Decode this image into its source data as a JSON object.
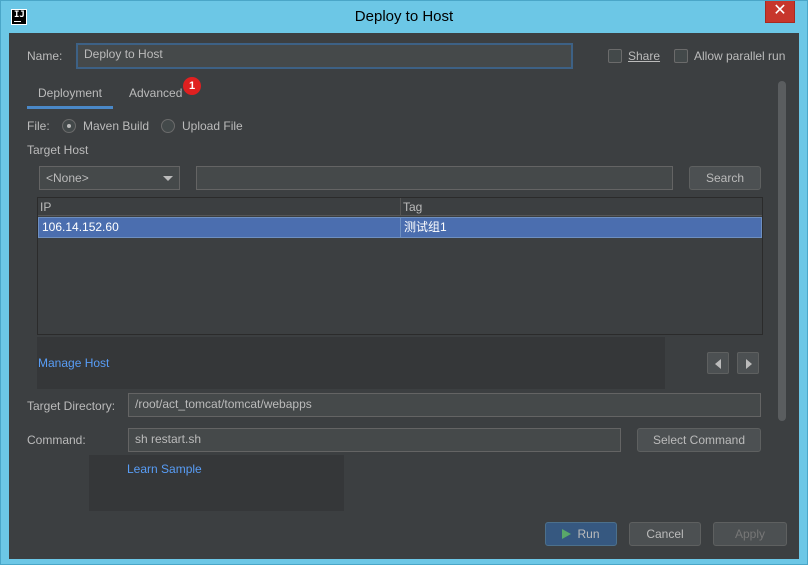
{
  "window": {
    "title": "Deploy to Host",
    "app_icon": "IJ",
    "close_symbol": "✕"
  },
  "name_row": {
    "label": "Name:",
    "value": "Deploy to Host",
    "share_label": "Share",
    "parallel_label": "Allow parallel run"
  },
  "tabs": [
    {
      "label": "Deployment"
    },
    {
      "label": "Advanced"
    }
  ],
  "badge": "1",
  "file_row": {
    "label": "File:",
    "options": [
      {
        "label": "Maven Build"
      },
      {
        "label": "Upload File"
      }
    ]
  },
  "target_host": {
    "label": "Target Host",
    "dropdown_value": "<None>",
    "search_value": "",
    "search_button": "Search"
  },
  "table": {
    "columns": [
      "IP",
      "Tag"
    ],
    "rows": [
      [
        "106.14.152.60",
        "测试组1"
      ]
    ]
  },
  "manage_host": "Manage Host",
  "target_directory": {
    "label": "Target Directory:",
    "value": "/root/act_tomcat/tomcat/webapps"
  },
  "command": {
    "label": "Command:",
    "value": "sh restart.sh",
    "select_button": "Select Command"
  },
  "learn_sample": "Learn Sample",
  "footer": {
    "run": "Run",
    "cancel": "Cancel",
    "apply": "Apply"
  },
  "colors": {
    "background": "#3c3f41",
    "titlebar": "#6cc7e6",
    "selection": "#4b6eaf",
    "link": "#589df6",
    "badge": "#e02020"
  }
}
